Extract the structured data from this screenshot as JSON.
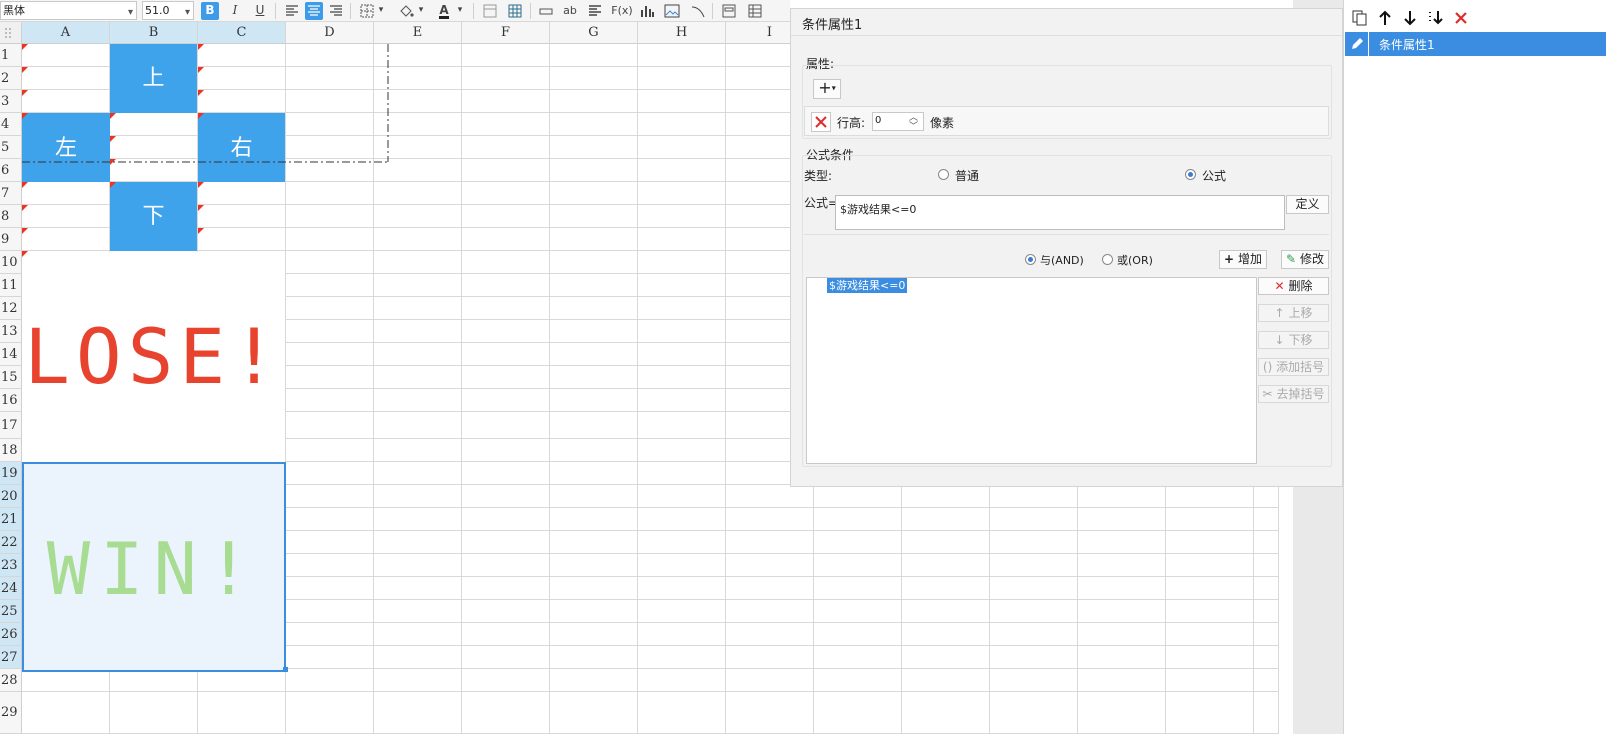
{
  "toolbar": {
    "font_name": "黑体",
    "font_size": "51.0",
    "bold_label": "B",
    "italic_label": "I",
    "underline_label": "U",
    "text_color_label": "A",
    "wrap_label": "ab",
    "formula_label": "F(x)"
  },
  "sheet": {
    "columns": [
      "A",
      "B",
      "C",
      "D",
      "E",
      "F",
      "G",
      "H",
      "I"
    ],
    "rows": [
      "1",
      "2",
      "3",
      "4",
      "5",
      "6",
      "7",
      "8",
      "9",
      "10",
      "11",
      "12",
      "13",
      "14",
      "15",
      "16",
      "17",
      "18",
      "19",
      "20",
      "21",
      "22",
      "23",
      "24",
      "25",
      "26",
      "27",
      "28",
      "29"
    ],
    "cells": {
      "up": "上",
      "left": "左",
      "right": "右",
      "down": "下",
      "lose": "LOSE!",
      "win": "WIN!"
    },
    "colors": {
      "key_blue": "#3fa3ec",
      "lose_red": "#e8432e",
      "win_green": "#a8dc92",
      "selection": "#3a8de0"
    }
  },
  "panel": {
    "title": "条件属性1",
    "attributes": {
      "section_label": "属性:",
      "add_icon": "plus-dropdown-icon",
      "row_height_label": "行高:",
      "row_height_value": "0",
      "unit_label": "像素"
    },
    "formula_section": {
      "section_label": "公式条件",
      "type_label": "类型:",
      "type_normal": "普通",
      "type_formula": "公式",
      "type_selected": "公式",
      "formula_label": "公式=",
      "formula_value": "$游戏结果<=0",
      "define_button": "定义",
      "and_label": "与(AND)",
      "or_label": "或(OR)",
      "logic_selected": "与(AND)",
      "add_button": "增加",
      "modify_button": "修改",
      "condition_items": [
        "$游戏结果<=0"
      ],
      "delete_button": "删除",
      "move_up_button": "上移",
      "move_down_button": "下移",
      "add_bracket_button": "添加括号",
      "remove_bracket_button": "去掉括号"
    }
  },
  "right_panel": {
    "icons": [
      "copy-icon",
      "arrow-up-icon",
      "arrow-down-icon",
      "move-bottom-icon",
      "close-red-icon"
    ],
    "items": [
      {
        "label": "条件属性1",
        "selected": true
      }
    ]
  }
}
